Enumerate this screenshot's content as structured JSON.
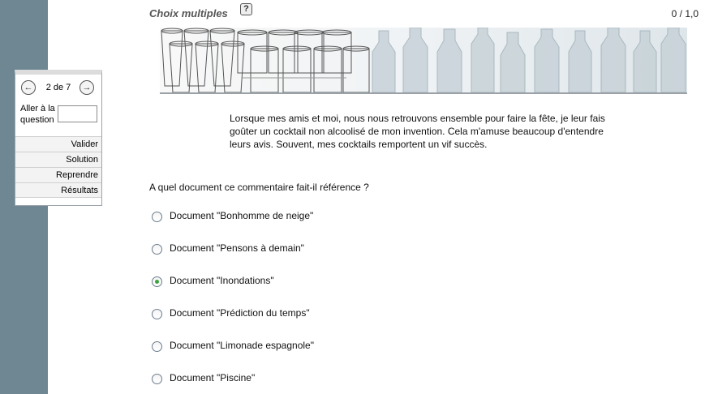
{
  "header": {
    "question_type": "Choix multiples",
    "help_label": "?",
    "score": "0 / 1,0"
  },
  "nav": {
    "prev_icon": "←",
    "next_icon": "→",
    "page_indicator": "2 de 7",
    "goto_label": "Aller à la question",
    "goto_value": "",
    "menu": [
      "Valider",
      "Solution",
      "Reprendre",
      "Résultats"
    ]
  },
  "banner": {
    "description": "glasses-and-bottles-banner"
  },
  "passage": "Lorsque mes amis et moi, nous nous retrouvons ensemble pour faire la fête, je leur fais goûter un cocktail non alcoolisé de mon invention. Cela m'amuse beaucoup d'entendre leurs avis. Souvent, mes cocktails remportent un vif succès.",
  "question": "A quel document ce commentaire fait-il référence ?",
  "options": [
    {
      "label": "Document \"Bonhomme de neige\"",
      "checked": false
    },
    {
      "label": "Document \"Pensons à demain\"",
      "checked": false
    },
    {
      "label": "Document \"Inondations\"",
      "checked": true
    },
    {
      "label": "Document \"Prédiction du temps\"",
      "checked": false
    },
    {
      "label": "Document \"Limonade espagnole\"",
      "checked": false
    },
    {
      "label": "Document \"Piscine\"",
      "checked": false
    }
  ],
  "colors": {
    "sidebar": "#6e8793",
    "radio_checked": "#3fa33f"
  }
}
